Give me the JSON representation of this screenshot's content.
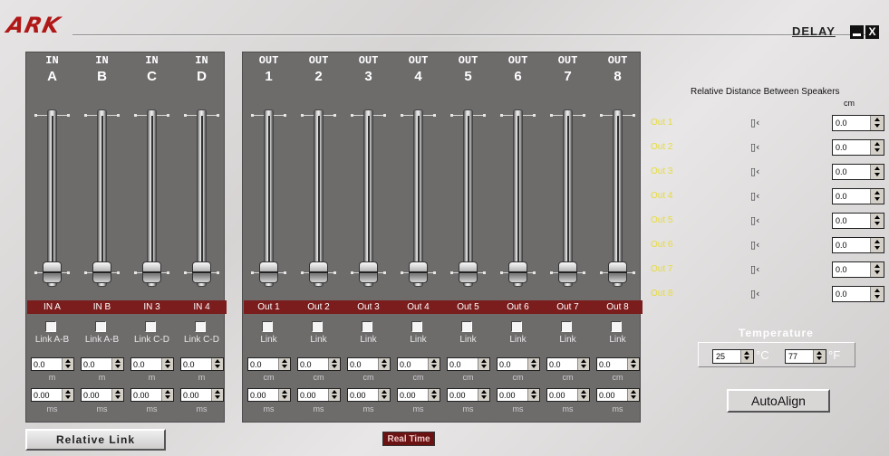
{
  "window": {
    "logo": "ARK",
    "title": "DELAY",
    "minimize_label": "",
    "close_label": "X"
  },
  "inputs": [
    {
      "head1": "IN",
      "head2": "A",
      "label": "IN A",
      "link": "Link A-B",
      "delay_a": "0.0",
      "unit_a": "m",
      "delay_b": "0.00",
      "unit_b": "ms",
      "level": 0
    },
    {
      "head1": "IN",
      "head2": "B",
      "label": "IN B",
      "link": "Link A-B",
      "delay_a": "0.0",
      "unit_a": "m",
      "delay_b": "0.00",
      "unit_b": "ms",
      "level": 0
    },
    {
      "head1": "IN",
      "head2": "C",
      "label": "IN 3",
      "link": "Link C-D",
      "delay_a": "0.0",
      "unit_a": "m",
      "delay_b": "0.00",
      "unit_b": "ms",
      "level": 0
    },
    {
      "head1": "IN",
      "head2": "D",
      "label": "IN 4",
      "link": "Link C-D",
      "delay_a": "0.0",
      "unit_a": "m",
      "delay_b": "0.00",
      "unit_b": "ms",
      "level": 0
    }
  ],
  "outputs": [
    {
      "head1": "OUT",
      "head2": "1",
      "label": "Out 1",
      "link": "Link",
      "delay_a": "0.0",
      "unit_a": "cm",
      "delay_b": "0.00",
      "unit_b": "ms",
      "level": 0
    },
    {
      "head1": "OUT",
      "head2": "2",
      "label": "Out 2",
      "link": "Link",
      "delay_a": "0.0",
      "unit_a": "cm",
      "delay_b": "0.00",
      "unit_b": "ms",
      "level": 0
    },
    {
      "head1": "OUT",
      "head2": "3",
      "label": "Out 3",
      "link": "Link",
      "delay_a": "0.0",
      "unit_a": "cm",
      "delay_b": "0.00",
      "unit_b": "ms",
      "level": 0
    },
    {
      "head1": "OUT",
      "head2": "4",
      "label": "Out 4",
      "link": "Link",
      "delay_a": "0.0",
      "unit_a": "cm",
      "delay_b": "0.00",
      "unit_b": "ms",
      "level": 0
    },
    {
      "head1": "OUT",
      "head2": "5",
      "label": "Out 5",
      "link": "Link",
      "delay_a": "0.0",
      "unit_a": "cm",
      "delay_b": "0.00",
      "unit_b": "ms",
      "level": 0
    },
    {
      "head1": "OUT",
      "head2": "6",
      "label": "Out 6",
      "link": "Link",
      "delay_a": "0.0",
      "unit_a": "cm",
      "delay_b": "0.00",
      "unit_b": "ms",
      "level": 0
    },
    {
      "head1": "OUT",
      "head2": "7",
      "label": "Out 7",
      "link": "Link",
      "delay_a": "0.0",
      "unit_a": "cm",
      "delay_b": "0.00",
      "unit_b": "ms",
      "level": 0
    },
    {
      "head1": "OUT",
      "head2": "8",
      "label": "Out 8",
      "link": "Link",
      "delay_a": "0.0",
      "unit_a": "cm",
      "delay_b": "0.00",
      "unit_b": "ms",
      "level": 0
    }
  ],
  "relative": {
    "title": "Relative Distance Between Speakers",
    "unit": "cm",
    "rows": [
      {
        "label": "Out 1",
        "value": "0.0"
      },
      {
        "label": "Out 2",
        "value": "0.0"
      },
      {
        "label": "Out 3",
        "value": "0.0"
      },
      {
        "label": "Out 4",
        "value": "0.0"
      },
      {
        "label": "Out 5",
        "value": "0.0"
      },
      {
        "label": "Out 6",
        "value": "0.0"
      },
      {
        "label": "Out 7",
        "value": "0.0"
      },
      {
        "label": "Out 8",
        "value": "0.0"
      }
    ]
  },
  "temperature": {
    "title": "Temperature",
    "celsius": "25",
    "celsius_unit": "°C",
    "fahrenheit": "77",
    "fahrenheit_unit": "°F"
  },
  "buttons": {
    "autoalign": "AutoAlign",
    "relative_link": "Relative Link",
    "realtime": "Real Time"
  },
  "colors": {
    "panel": "#6e6b6b",
    "channel_label": "#7b1d1d",
    "out_label_text": "#e6dc3c",
    "logo": "#b01818"
  },
  "icons": {
    "speaker": "speaker-icon",
    "spin": "spin-arrows-icon"
  }
}
